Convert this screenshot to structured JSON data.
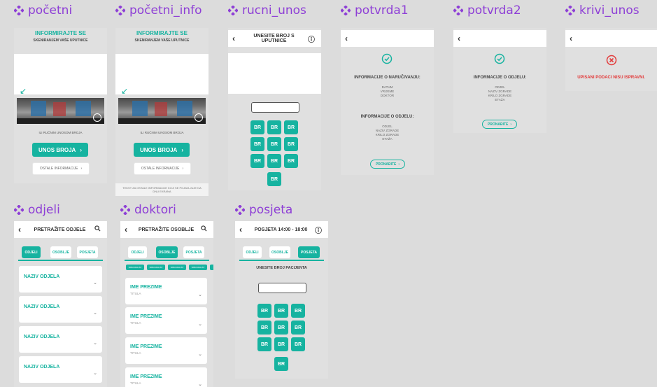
{
  "colors": {
    "accent": "#16b3a0",
    "title": "#8e3fd6",
    "error": "#e23b3b"
  },
  "frames": {
    "pocetni": {
      "name": "početni",
      "headline": "INFORMIRAJTE SE",
      "subline": "SKENIRANJEM VAŠE UPUTNICE",
      "manual_text": "ILI RUČNIM UNOSOM BROJA",
      "primary_btn": "UNOS BROJA",
      "secondary_btn": "OSTALE INFORMACIJE"
    },
    "pocetni_info": {
      "name": "početni_info",
      "headline": "INFORMIRAJTE SE",
      "subline": "SKENIRANJEM VAŠE UPUTNICE",
      "manual_text": "ILI RUČNIM UNOSOM BROJA",
      "primary_btn": "UNOS BROJA",
      "secondary_btn": "OSTALE INFORMACIJE",
      "footnote": "TEKST ZA OSTALE INFORMACIJE KOJI SE POJAVLJUJE NA DNU EKRANA"
    },
    "rucni_unos": {
      "name": "rucni_unos",
      "header": "UNESITE BROJ S UPUTNICE",
      "keys": [
        "BR",
        "BR",
        "BR",
        "BR",
        "BR",
        "BR",
        "BR",
        "BR",
        "BR",
        "BR"
      ]
    },
    "potvrda1": {
      "name": "potvrda1",
      "section1_title": "INFORMACIJE O NARUČIVANJU:",
      "section1_lines": [
        "DATUM",
        "VRIJEME",
        "DOKTOR"
      ],
      "section2_title": "INFORMACIJE O ODJELU:",
      "section2_lines": [
        "ODJEL",
        "NAZIV ZGRADE",
        "KRILO ZGRADE",
        "ETAŽA"
      ],
      "button": "PRONAĐITE"
    },
    "potvrda2": {
      "name": "potvrda2",
      "section_title": "INFORMACIJE O ODJELU:",
      "section_lines": [
        "ODJEL",
        "NAZIV ZGRADE",
        "KRILO ZGRADE",
        "ETAŽA"
      ],
      "button": "PRONAĐITE"
    },
    "krivi_unos": {
      "name": "krivi_unos",
      "error_text": "UPISANI PODACI NISU ISPRAVNI."
    },
    "odjeli": {
      "name": "odjeli",
      "search": "PRETRAŽITE ODJELE",
      "tabs": [
        "ODJELI",
        "OSOBLJE",
        "POSJETA"
      ],
      "cards": [
        "NAZIV ODJELA",
        "NAZIV ODJELA",
        "NAZIV ODJELA",
        "NAZIV ODJELA"
      ]
    },
    "doktori": {
      "name": "doktori",
      "search": "PRETRAŽITE OSOBLJE",
      "tabs": [
        "ODJELI",
        "OSOBLJE",
        "POSJETA"
      ],
      "chips": [
        "SPECIJALIST",
        "SPECIJALIST",
        "SPECIJALIST",
        "SPECIJALIST"
      ],
      "card_title": "IME PREZIME",
      "card_sub": "TITULA",
      "cards": [
        "IME PREZIME",
        "IME PREZIME",
        "IME PREZIME",
        "IME PREZIME"
      ]
    },
    "posjeta": {
      "name": "posjeta",
      "header": "POSJETA 14:00 - 18:00",
      "tabs": [
        "ODJELI",
        "OSOBLJE",
        "POSJETA"
      ],
      "prompt": "UNESITE BROJ PACIJENTA",
      "keys": [
        "BR",
        "BR",
        "BR",
        "BR",
        "BR",
        "BR",
        "BR",
        "BR",
        "BR",
        "BR"
      ]
    }
  }
}
